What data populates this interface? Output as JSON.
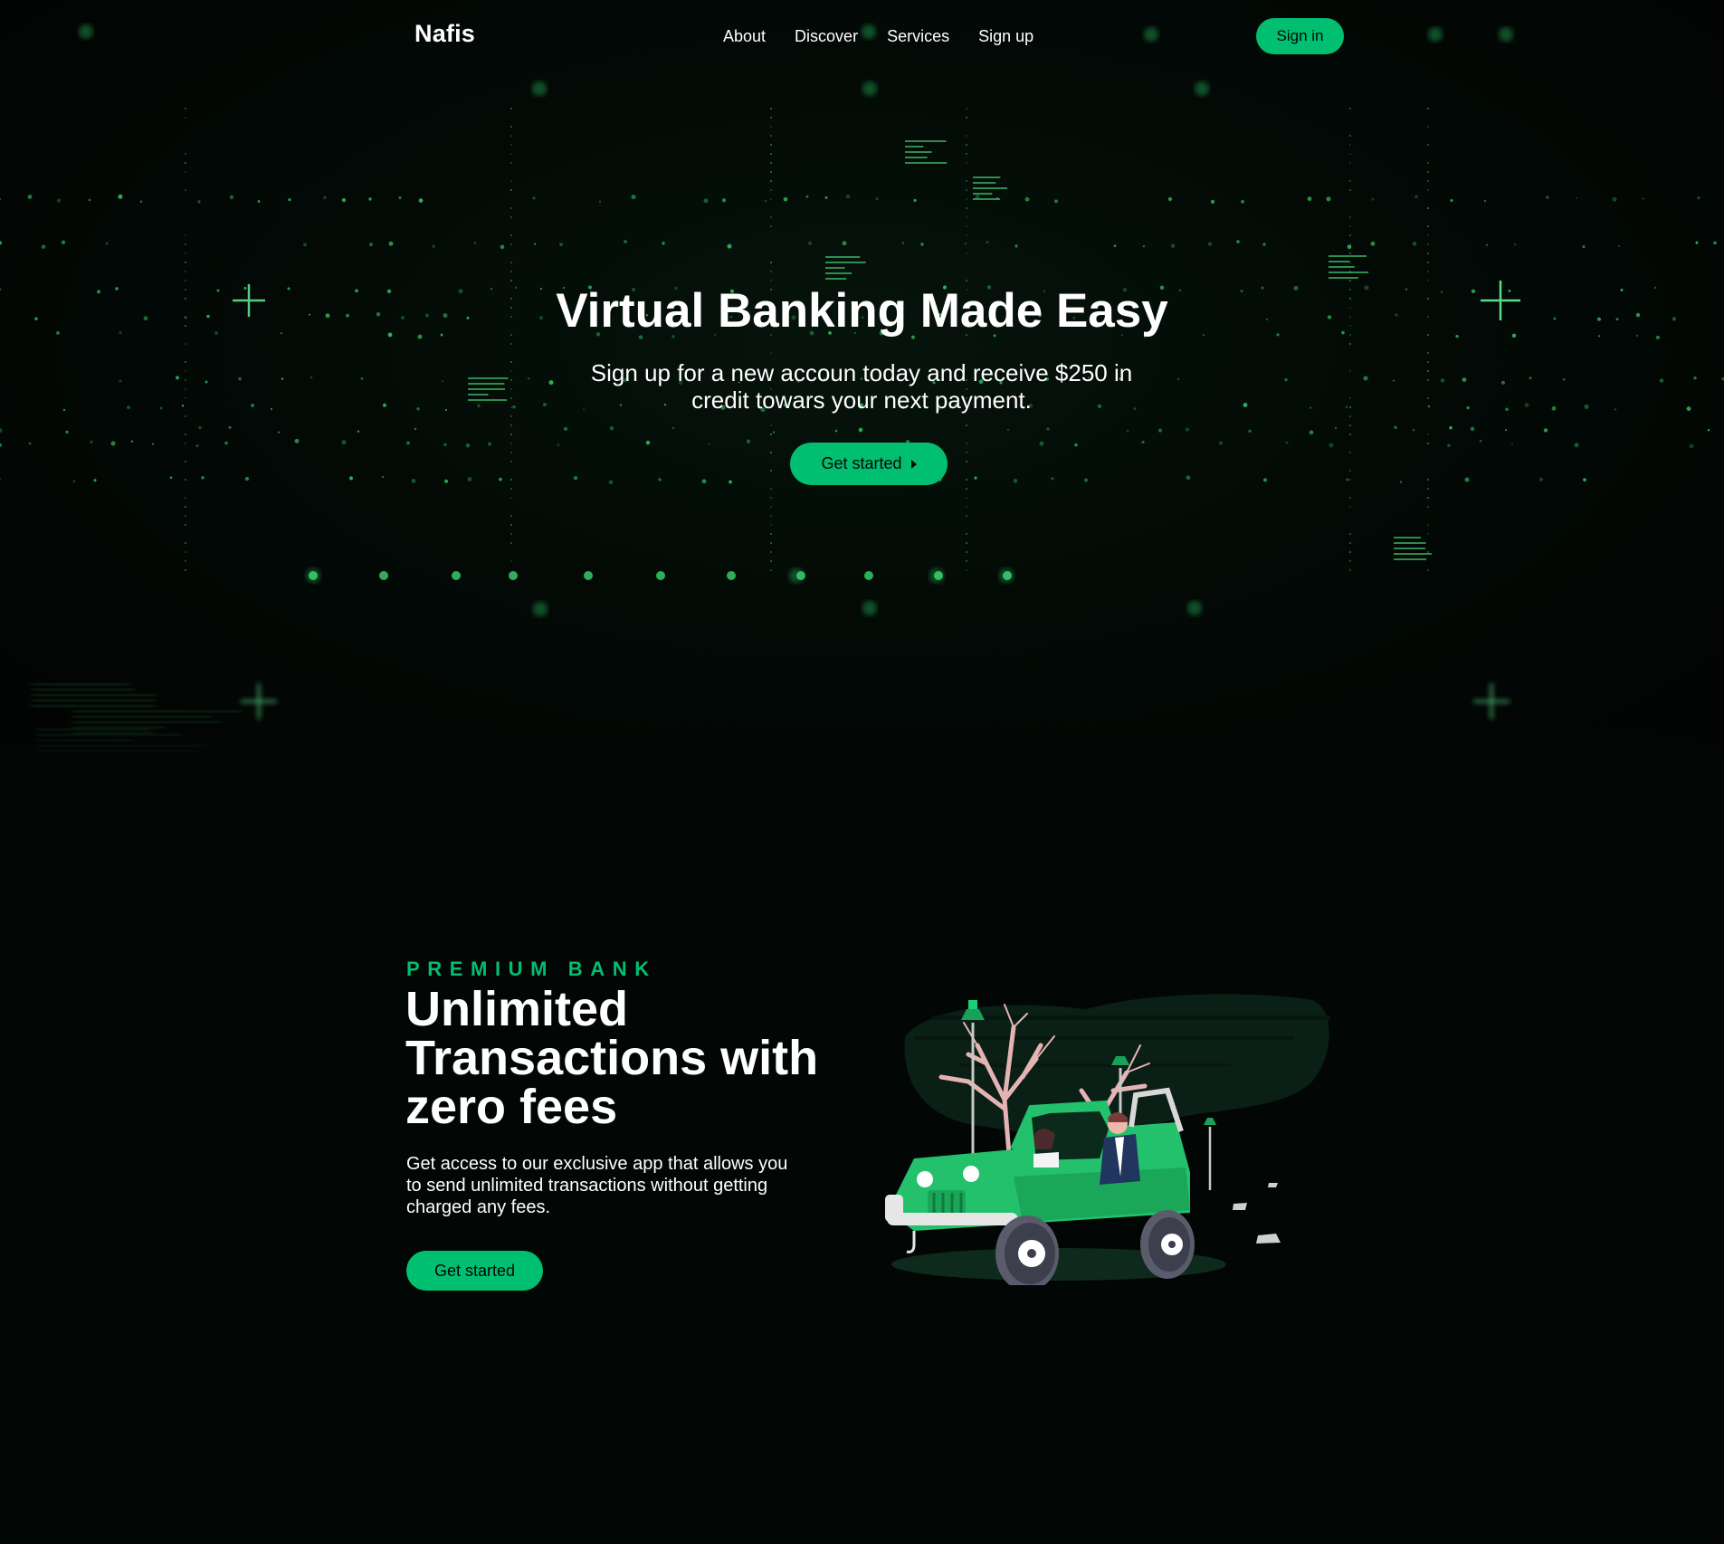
{
  "colors": {
    "accent": "#01bf71",
    "background": "#020605",
    "text": "#ffffff",
    "button_text": "#010606"
  },
  "navbar": {
    "logo": "Nafis",
    "links": [
      {
        "label": "About"
      },
      {
        "label": "Discover"
      },
      {
        "label": "Services"
      },
      {
        "label": "Sign up"
      }
    ],
    "signin_label": "Sign in"
  },
  "hero": {
    "title": "Virtual Banking Made Easy",
    "subtitle": "Sign up for a new accoun today and receive $250 in credit towars your next payment.",
    "button_label": "Get started",
    "button_icon": "chevron-right-icon"
  },
  "info": {
    "top_line": "PREMIUM BANK",
    "heading": "Unlimited Transactions with zero fees",
    "description": "Get access to our exclusive app that allows you to send unlimited transactions without getting charged any fees.",
    "button_label": "Get started",
    "illustration": "green-jeep-illustration"
  }
}
